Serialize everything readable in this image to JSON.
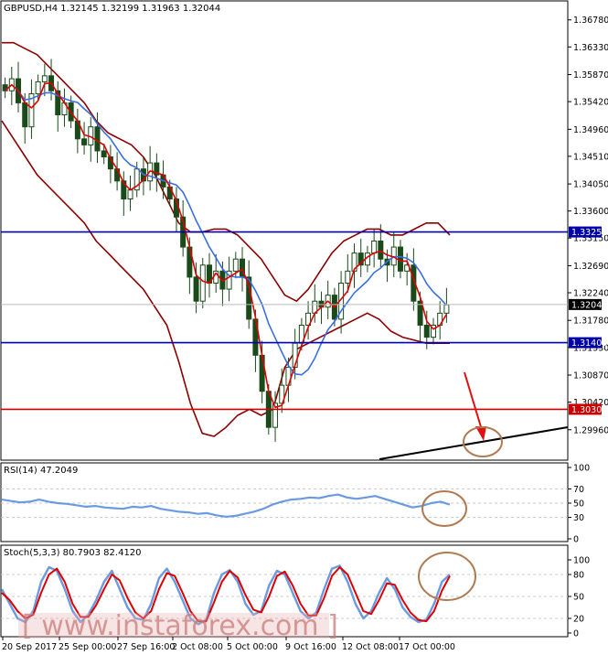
{
  "chart_data": [
    {
      "type": "candlestick",
      "title": "GBPUSD,H4  1.32145 1.32199 1.31963 1.32044",
      "ylim": [
        1.295,
        1.3705
      ],
      "y_ticks": [
        "1.36780",
        "1.36330",
        "1.35870",
        "1.35420",
        "1.34960",
        "1.34510",
        "1.34050",
        "1.33600",
        "1.33150",
        "1.32690",
        "1.32240",
        "1.31780",
        "1.31330",
        "1.30870",
        "1.30420",
        "1.29960"
      ],
      "x_labels": [
        "20 Sep 2017",
        "25 Sep 00:00",
        "27 Sep 16:00",
        "2 Oct 08:00",
        "5 Oct 00:00",
        "9 Oct 16:00",
        "12 Oct 08:00",
        "17 Oct 00:00"
      ],
      "current_price": "1.32044",
      "levels": [
        {
          "name": "resistance",
          "value": 1.33251,
          "label": "1.33251",
          "color": "#0000aa"
        },
        {
          "name": "support",
          "value": 1.31409,
          "label": "1.31409",
          "color": "#0000aa"
        },
        {
          "name": "target",
          "value": 1.303,
          "label": "1.30300",
          "color": "#cc0000"
        }
      ],
      "close": [
        1.356,
        1.358,
        1.354,
        1.35,
        1.3555,
        1.3575,
        1.3585,
        1.356,
        1.352,
        1.354,
        1.351,
        1.348,
        1.347,
        1.35,
        1.346,
        1.345,
        1.343,
        1.341,
        1.338,
        1.3395,
        1.343,
        1.341,
        1.344,
        1.342,
        1.34,
        1.338,
        1.335,
        1.33,
        1.325,
        1.321,
        1.327,
        1.324,
        1.326,
        1.323,
        1.326,
        1.328,
        1.325,
        1.318,
        1.312,
        1.306,
        1.3,
        1.304,
        1.307,
        1.31,
        1.314,
        1.317,
        1.319,
        1.321,
        1.32,
        1.322,
        1.318,
        1.324,
        1.326,
        1.329,
        1.327,
        1.329,
        1.331,
        1.328,
        1.327,
        1.33,
        1.326,
        1.327,
        1.321,
        1.317,
        1.315,
        1.317,
        1.319,
        1.3204
      ],
      "bollinger_upper": [
        1.364,
        1.364,
        1.363,
        1.362,
        1.36,
        1.358,
        1.356,
        1.354,
        1.351,
        1.349,
        1.348,
        1.347,
        1.345,
        1.342,
        1.338,
        1.334,
        1.3325,
        1.3325,
        1.333,
        1.333,
        1.332,
        1.33,
        1.328,
        1.325,
        1.322,
        1.321,
        1.323,
        1.326,
        1.329,
        1.331,
        1.332,
        1.333,
        1.333,
        1.332,
        1.332,
        1.333,
        1.334,
        1.334,
        1.332
      ],
      "bollinger_lower": [
        1.351,
        1.348,
        1.345,
        1.342,
        1.34,
        1.338,
        1.336,
        1.334,
        1.331,
        1.329,
        1.327,
        1.325,
        1.323,
        1.32,
        1.317,
        1.311,
        1.304,
        1.299,
        1.2985,
        1.3,
        1.302,
        1.303,
        1.302,
        1.303,
        1.31,
        1.313,
        1.314,
        1.315,
        1.316,
        1.317,
        1.318,
        1.319,
        1.318,
        1.316,
        1.315,
        1.3145,
        1.314,
        1.314,
        1.314
      ]
    },
    {
      "type": "line",
      "title": "RSI(14) 47.2049",
      "ylim": [
        0,
        100
      ],
      "y_ticks": [
        "100",
        "70",
        "50",
        "30",
        "0"
      ],
      "series": [
        {
          "values": [
            55,
            53,
            51,
            52,
            55,
            52,
            50,
            49,
            47,
            45,
            46,
            44,
            43,
            42,
            45,
            44,
            46,
            42,
            40,
            38,
            37,
            35,
            36,
            33,
            31,
            32,
            35,
            38,
            42,
            48,
            52,
            55,
            56,
            58,
            57,
            60,
            62,
            58,
            56,
            58,
            60,
            56,
            52,
            48,
            44,
            46,
            50,
            52,
            48
          ]
        }
      ]
    },
    {
      "type": "line",
      "title": "Stoch(5,3,3) 80.7903 82.4120",
      "ylim": [
        0,
        100
      ],
      "y_ticks": [
        "100",
        "80",
        "50",
        "20",
        "0"
      ],
      "series": [
        {
          "values": [
            60,
            40,
            20,
            15,
            30,
            70,
            90,
            85,
            60,
            30,
            15,
            25,
            45,
            70,
            85,
            60,
            35,
            20,
            18,
            40,
            75,
            88,
            70,
            45,
            20,
            12,
            18,
            55,
            80,
            86,
            70,
            40,
            25,
            30,
            65,
            85,
            80,
            55,
            30,
            20,
            28,
            60,
            88,
            92,
            70,
            40,
            20,
            30,
            55,
            75,
            60,
            35,
            22,
            15,
            18,
            40,
            70,
            80
          ]
        },
        {
          "values": [
            55,
            45,
            30,
            20,
            25,
            55,
            80,
            88,
            70,
            40,
            22,
            22,
            38,
            60,
            80,
            72,
            48,
            28,
            20,
            30,
            60,
            82,
            78,
            55,
            30,
            16,
            16,
            42,
            70,
            85,
            76,
            52,
            32,
            28,
            50,
            78,
            84,
            65,
            40,
            24,
            24,
            48,
            78,
            90,
            80,
            55,
            30,
            26,
            45,
            68,
            66,
            45,
            28,
            18,
            16,
            30,
            58,
            78
          ]
        }
      ]
    }
  ],
  "watermark": "[  www.instaforex.com  ]",
  "colors": {
    "price_ma_red": "#dd0000",
    "price_ma_blue": "#3a6fe0",
    "bollinger": "#8b0000",
    "level_blue": "#0000aa",
    "level_red": "#cc0000",
    "rsi_line": "#6a9ae0",
    "annotation": "#b07a50"
  }
}
